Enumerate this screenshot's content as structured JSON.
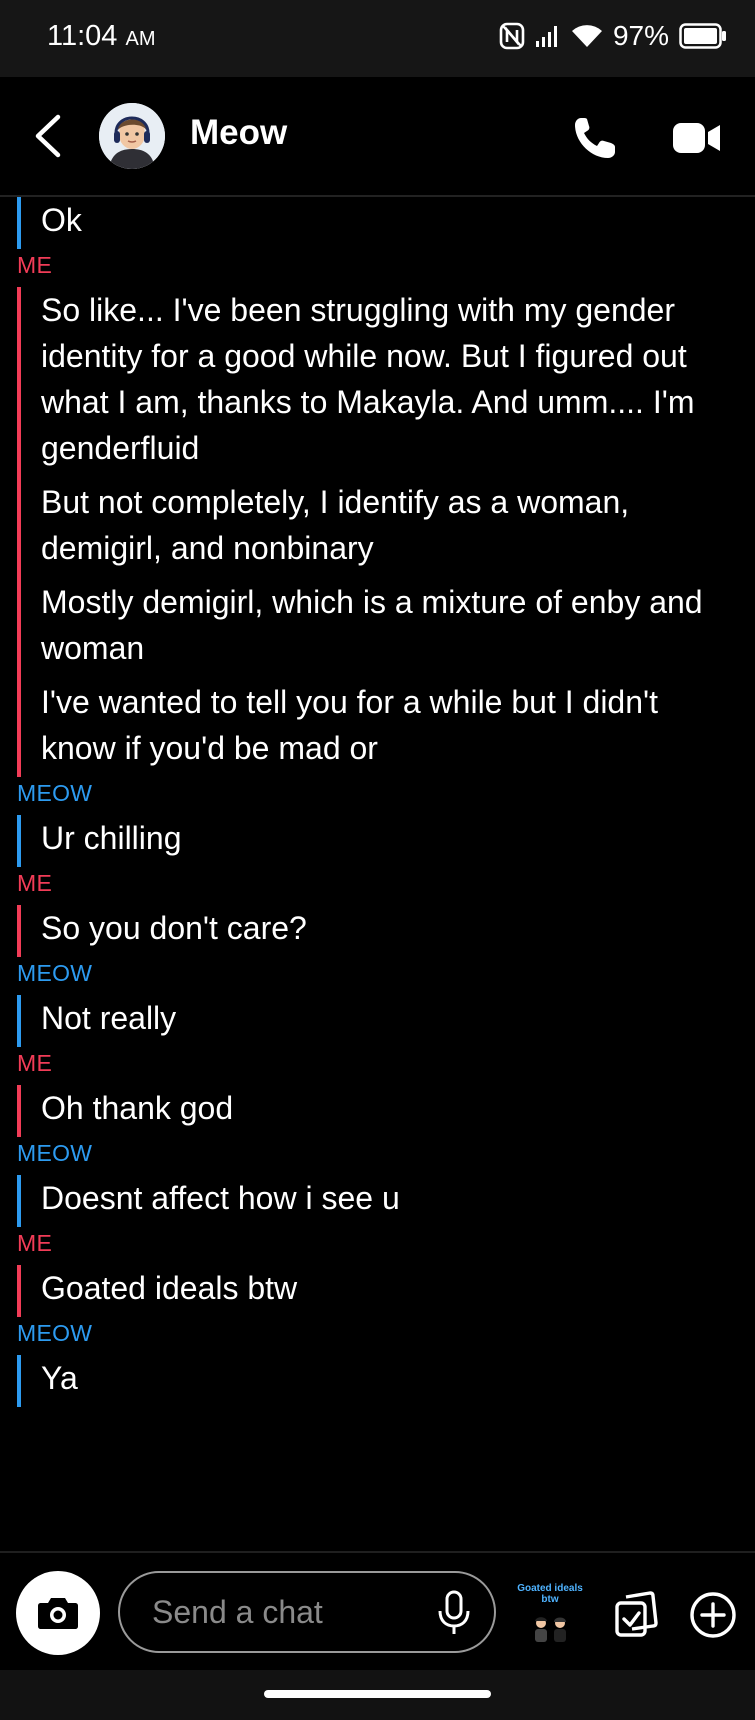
{
  "status_bar": {
    "time": "11:04",
    "ampm": "AM",
    "battery": "97%"
  },
  "header": {
    "name": "Meow"
  },
  "messages": [
    {
      "sender": "",
      "side": "meow",
      "texts": [
        "Ok"
      ]
    },
    {
      "sender": "ME",
      "side": "me",
      "texts": [
        "So like... I've been struggling with my gender identity for a good while now. But I figured out what I am, thanks to Makayla. And umm.... I'm genderfluid",
        "But not completely, I identify as a woman, demigirl, and nonbinary",
        "Mostly demigirl, which is a mixture of enby and woman",
        "I've wanted to tell you for a while but I didn't know if you'd be mad or"
      ]
    },
    {
      "sender": "MEOW",
      "side": "meow",
      "texts": [
        "Ur chilling"
      ]
    },
    {
      "sender": "ME",
      "side": "me",
      "texts": [
        "So you don't care?"
      ]
    },
    {
      "sender": "MEOW",
      "side": "meow",
      "texts": [
        "Not really"
      ]
    },
    {
      "sender": "ME",
      "side": "me",
      "texts": [
        "Oh thank god"
      ]
    },
    {
      "sender": "MEOW",
      "side": "meow",
      "texts": [
        "Doesnt affect how i see u"
      ]
    },
    {
      "sender": "ME",
      "side": "me",
      "texts": [
        "Goated ideals btw"
      ]
    },
    {
      "sender": "MEOW",
      "side": "meow",
      "texts": [
        "Ya"
      ]
    }
  ],
  "footer": {
    "placeholder": "Send a chat",
    "sticker_text": "Goated ideals btw"
  },
  "colors": {
    "me": "#f23c57",
    "meow": "#2d9bf0"
  },
  "icons": [
    "back-icon",
    "phone-icon",
    "video-icon",
    "camera-icon",
    "mic-icon",
    "memories-icon",
    "plus-icon"
  ]
}
